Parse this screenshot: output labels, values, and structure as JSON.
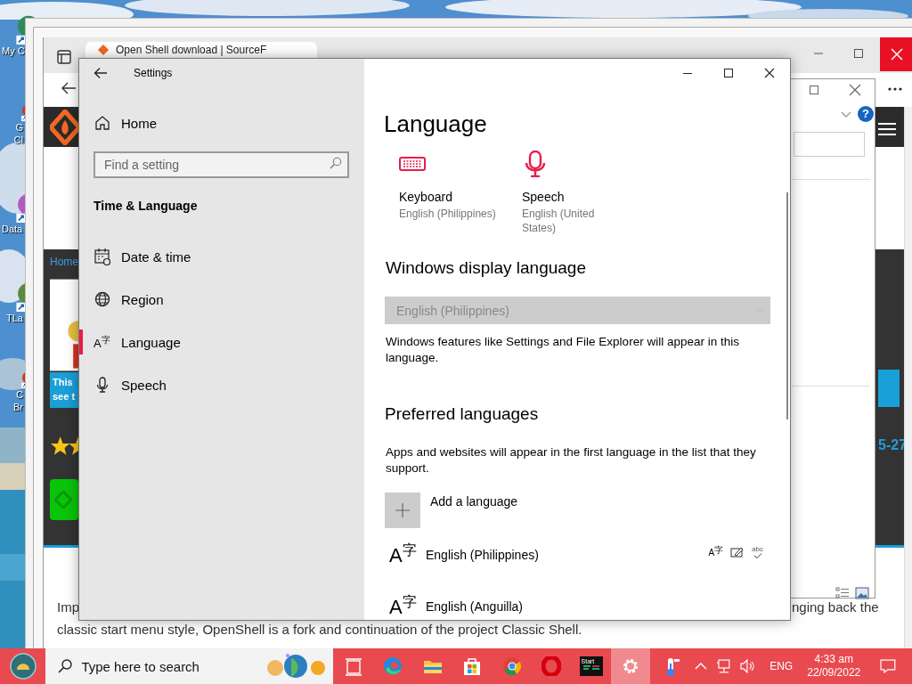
{
  "desktop": {
    "icons": [
      {
        "lines": [
          "My C"
        ]
      },
      {
        "lines": [
          "G",
          "Cl"
        ]
      },
      {
        "lines": [
          "Data"
        ]
      },
      {
        "lines": [
          "TLa"
        ]
      },
      {
        "lines": [
          "C",
          "Br"
        ]
      }
    ]
  },
  "browser": {
    "tab_title": "Open Shell download | SourceF",
    "page": {
      "nav_link": "Home",
      "banner_lines": [
        "This",
        "see t"
      ],
      "side_text": "5-27",
      "body_start": "Imp",
      "body_end": "nging back the",
      "body_line_2": "classic start menu style, OpenShell is a fork and continuation of the project Classic Shell."
    },
    "dialog": {
      "help_glyph": "?"
    }
  },
  "settings": {
    "title": "Settings",
    "home": "Home",
    "search": {
      "placeholder": "Find a setting"
    },
    "section": "Time & Language",
    "nav": [
      {
        "label": "Date & time",
        "kind": "calendar",
        "selected": false
      },
      {
        "label": "Region",
        "kind": "globe",
        "selected": false
      },
      {
        "label": "Language",
        "kind": "glyph",
        "glyph": "A$^{字}$",
        "selected": true
      },
      {
        "label": "Speech",
        "kind": "microphone",
        "selected": false
      }
    ],
    "page": {
      "heading": "Language",
      "shortcuts": [
        {
          "kind": "keyboard",
          "label": "Keyboard",
          "value": "English (Philippines)"
        },
        {
          "kind": "microphone",
          "label": "Speech",
          "value": "English (United States)"
        }
      ],
      "display_language": {
        "heading": "Windows display language",
        "dropdown": {
          "value": "English (Philippines)",
          "disabled": true
        },
        "description": "Windows features like Settings and File Explorer will appear in this language."
      },
      "preferred": {
        "heading": "Preferred languages",
        "description": "Apps and websites will appear in the first language in the list that they support.",
        "add_label": "Add a language",
        "languages": [
          {
            "glyph": "A$^{字}$",
            "name": "English (Philippines)",
            "features": [
              {
                "kind": "glyph",
                "text": "A$^{字}$"
              },
              {
                "kind": "handwriting"
              },
              {
                "kind": "spelling",
                "text": "abc"
              }
            ]
          },
          {
            "glyph": "A$^{字}$",
            "name": "English (Anguilla)"
          }
        ]
      }
    }
  },
  "taskbar": {
    "search_placeholder": "Type here to search",
    "apps": [
      {
        "kind": "task-view",
        "active": false
      },
      {
        "kind": "edge",
        "active": false
      },
      {
        "kind": "explorer",
        "active": false
      },
      {
        "kind": "store",
        "active": false
      },
      {
        "kind": "chrome",
        "active": false
      },
      {
        "kind": "opera",
        "active": false
      },
      {
        "kind": "terminal",
        "label": "Start",
        "active": false
      },
      {
        "kind": "settings",
        "active": true
      },
      {
        "kind": "thermometer",
        "active": false
      }
    ],
    "language": "ENG",
    "time": "4:33 am",
    "date": "22/09/2022"
  }
}
